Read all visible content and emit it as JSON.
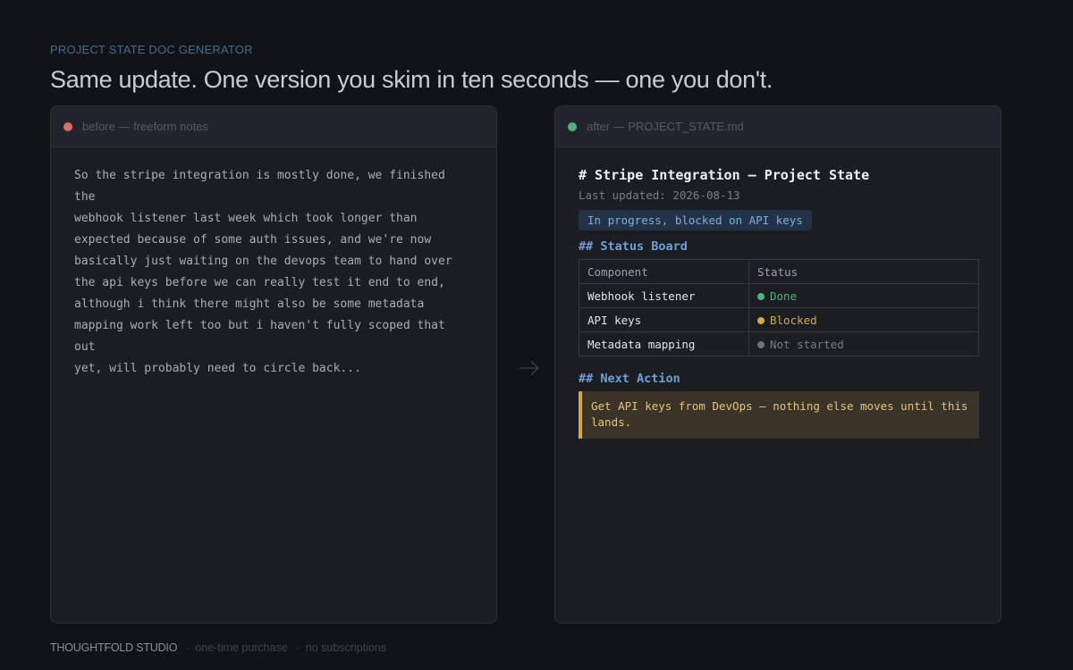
{
  "eyebrow": "PROJECT STATE DOC GENERATOR",
  "headline": "Same update. One version you skim in ten seconds — one you don't.",
  "before": {
    "label": "before — freeform notes",
    "notes": "So the stripe integration is mostly done, we finished the\nwebhook listener last week which took longer than\nexpected because of some auth issues, and we're now\nbasically just waiting on the devops team to hand over\nthe api keys before we can really test it end to end,\nalthough i think there might also be some metadata\nmapping work left too but i haven't fully scoped that out\nyet, will probably need to circle back..."
  },
  "after": {
    "label": "after — PROJECT_STATE.md",
    "title": "# Stripe Integration — Project State",
    "updated": "Last updated: 2026-08-13",
    "status_pill": "In progress, blocked on API keys",
    "status_board_heading": "## Status Board",
    "table": {
      "headers": [
        "Component",
        "Status"
      ],
      "rows": [
        {
          "component": "Webhook listener",
          "status": "Done",
          "state": "done"
        },
        {
          "component": "API keys",
          "status": "Blocked",
          "state": "blocked"
        },
        {
          "component": "Metadata mapping",
          "status": "Not started",
          "state": "notstarted"
        }
      ]
    },
    "next_action_heading": "## Next Action",
    "next_action": "Get API keys from DevOps — nothing else moves until this lands."
  },
  "footer": {
    "brand": "THOUGHTFOLD STUDIO",
    "tags": [
      "one-time purchase",
      "no subscriptions"
    ]
  },
  "colors": {
    "background": "#121316",
    "done": "#4fb27a",
    "blocked": "#d7a84a",
    "not_started": "#6f737b",
    "accent_heading": "#6f9fd6"
  },
  "icons": {
    "before_dot": "red-dot-icon",
    "after_dot": "green-dot-icon",
    "arrow": "arrow-right-icon"
  }
}
